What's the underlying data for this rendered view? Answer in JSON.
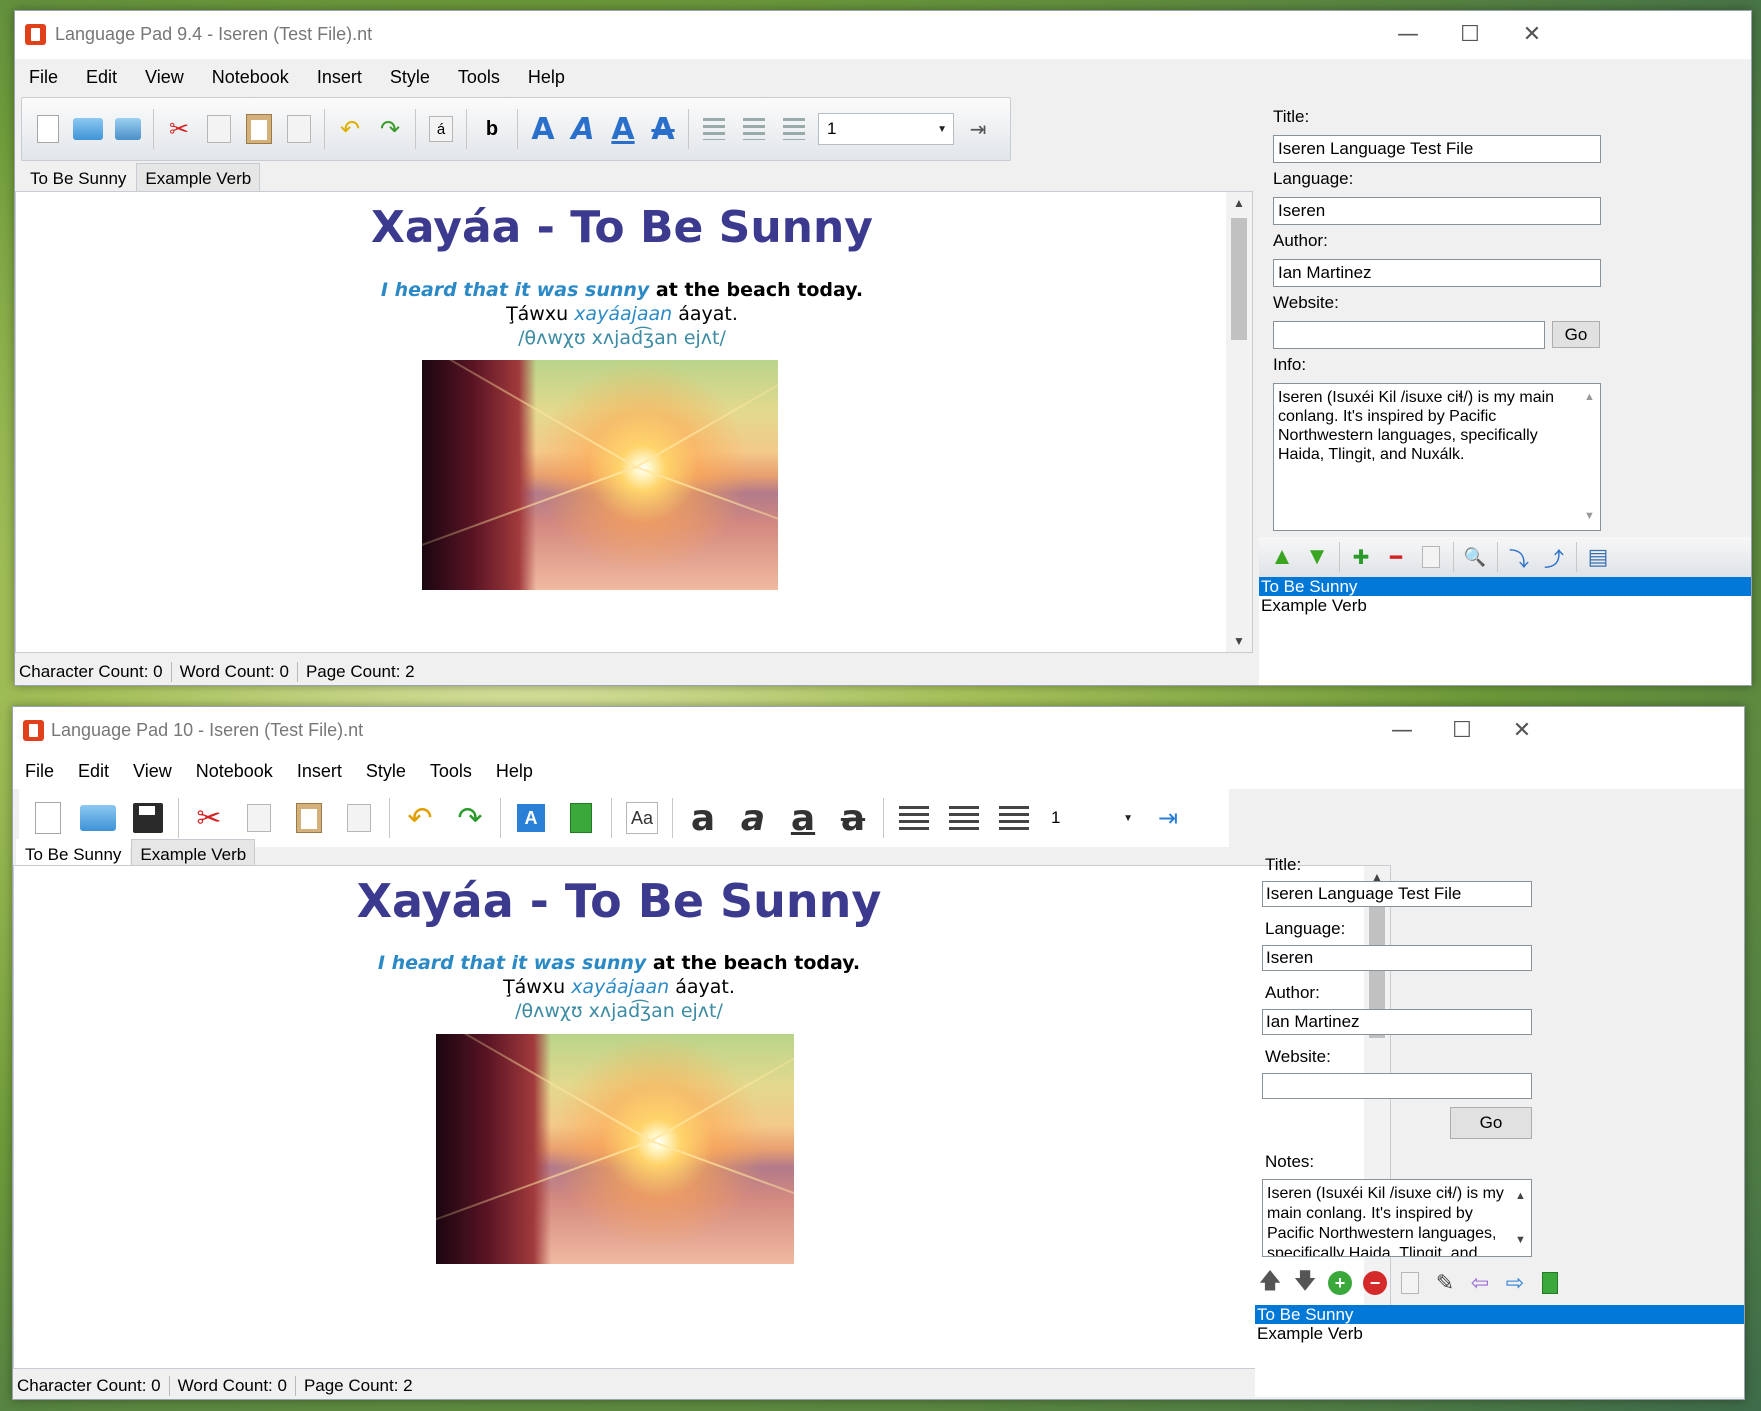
{
  "windows": [
    {
      "title": "Language Pad 9.4 - Iseren (Test File).nt",
      "window_controls": {
        "minimize": "—",
        "maximize": "☐",
        "close": "✕"
      },
      "menu": [
        "File",
        "Edit",
        "View",
        "Notebook",
        "Insert",
        "Style",
        "Tools",
        "Help"
      ],
      "toolbar": {
        "icons": [
          "new-file-icon",
          "open-folder-icon",
          "save-icon",
          "cut-icon",
          "copy-icon",
          "paste-icon",
          "document-icon",
          "undo-icon",
          "redo-icon",
          "special-character-icon",
          "bold-b-icon",
          "text-style-bold-icon",
          "text-style-italic-icon",
          "text-style-underline-icon",
          "text-style-strikethrough-icon",
          "align-left-icon",
          "align-center-icon",
          "align-right-icon",
          "indent-icon"
        ],
        "special_char": "á",
        "bold_glyph": "b",
        "style_glyph": "A",
        "spacing_value": "1"
      },
      "tabs": [
        {
          "label": "To Be Sunny",
          "active": true
        },
        {
          "label": "Example Verb",
          "active": false
        }
      ],
      "document": {
        "title": "Xayáa - To Be Sunny",
        "line1_italic": "I heard that it was sunny",
        "line1_bold": " at the beach today.",
        "line2_plain1": "Ţáwxu ",
        "line2_italic": "xayáajaan",
        "line2_plain2": " áayat.",
        "ipa": "/θʌwχʊ xʌjad͡ʒan ejʌt/"
      },
      "status": {
        "characters": "Character Count: 0",
        "words": "Word Count: 0",
        "pages": "Page Count: 2"
      },
      "properties": {
        "title_label": "Title:",
        "title_value": "Iseren Language Test File",
        "language_label": "Language:",
        "language_value": "Iseren",
        "author_label": "Author:",
        "author_value": "Ian Martinez",
        "website_label": "Website:",
        "website_value": "",
        "go_label": "Go",
        "info_label": "Info:",
        "info_value": "Iseren (Isuxéi Kil /isuxe ciɬ/) is my main conlang. It's inspired by Pacific Northwestern languages, specifically Haida, Tlingit, and Nuxálk."
      },
      "page_toolbar_icons": [
        "move-up-icon",
        "move-down-icon",
        "add-page-icon",
        "remove-page-icon",
        "copy-page-icon",
        "find-icon",
        "import-icon",
        "export-icon",
        "notebook-icon"
      ],
      "pages": [
        {
          "label": "To Be Sunny",
          "selected": true
        },
        {
          "label": "Example Verb",
          "selected": false
        }
      ]
    },
    {
      "title": "Language Pad 10 - Iseren (Test File).nt",
      "window_controls": {
        "minimize": "—",
        "maximize": "☐",
        "close": "✕"
      },
      "menu": [
        "File",
        "Edit",
        "View",
        "Notebook",
        "Insert",
        "Style",
        "Tools",
        "Help"
      ],
      "toolbar": {
        "icons": [
          "new-file-icon",
          "open-folder-icon",
          "save-icon",
          "cut-icon",
          "copy-icon",
          "paste-icon",
          "document-icon",
          "undo-icon",
          "redo-icon",
          "font-icon",
          "notebook-icon",
          "text-case-icon",
          "text-style-bold-icon",
          "text-style-italic-icon",
          "text-style-underline-icon",
          "text-style-strikethrough-icon",
          "align-left-icon",
          "align-center-icon",
          "align-right-icon",
          "indent-icon"
        ],
        "font_glyph": "A",
        "case_label": "Aa",
        "style_glyph": "a",
        "spacing_value": "1"
      },
      "tabs": [
        {
          "label": "To Be Sunny",
          "active": true
        },
        {
          "label": "Example Verb",
          "active": false
        }
      ],
      "document": {
        "title": "Xayáa - To Be Sunny",
        "line1_italic": "I heard that it was sunny",
        "line1_bold": " at the beach today.",
        "line2_plain1": "Ţáwxu ",
        "line2_italic": "xayáajaan",
        "line2_plain2": " áayat.",
        "ipa": "/θʌwχʊ xʌjad͡ʒan ejʌt/"
      },
      "status": {
        "characters": "Character Count: 0",
        "words": "Word Count: 0",
        "pages": "Page Count: 2"
      },
      "properties": {
        "title_label": "Title:",
        "title_value": "Iseren Language Test File",
        "language_label": "Language:",
        "language_value": "Iseren",
        "author_label": "Author:",
        "author_value": "Ian Martinez",
        "website_label": "Website:",
        "website_value": "",
        "go_label": "Go",
        "info_label": "Notes:",
        "info_value": "Iseren (Isuxéi Kil /isuxe ciɬ/) is my main conlang. It's inspired by Pacific Northwestern languages, specifically Haida, Tlingit, and Nuxálk."
      },
      "page_toolbar_icons": [
        "move-up-icon",
        "move-down-icon",
        "add-page-icon",
        "remove-page-icon",
        "copy-page-icon",
        "rename-icon",
        "import-icon",
        "export-icon",
        "notebook-icon"
      ],
      "pages": [
        {
          "label": "To Be Sunny",
          "selected": true
        },
        {
          "label": "Example Verb",
          "selected": false
        }
      ]
    }
  ],
  "colors": {
    "doc_title": "#3b3a8e",
    "italic_blue": "#2b8ac6",
    "ipa_teal": "#3c8ba3",
    "selection": "#0078d7",
    "app_icon": "#e0411b"
  }
}
